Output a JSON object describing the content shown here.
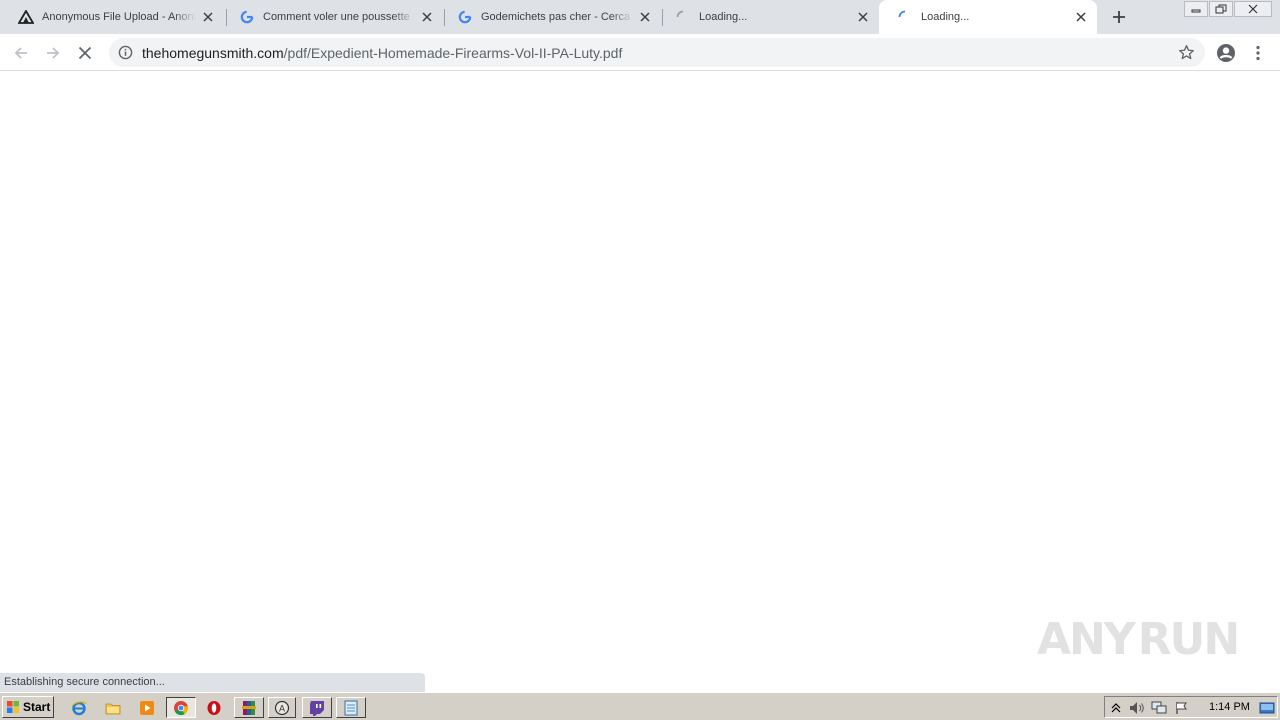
{
  "browser": {
    "tabs": [
      {
        "title": "Anonymous File Upload - AnonFiles",
        "favicon": "anonfiles-icon",
        "state": "inactive"
      },
      {
        "title": "Comment voler une poussette ?",
        "favicon": "google-g-icon",
        "state": "inactive"
      },
      {
        "title": "Godemichets pas cher - Cerca con Google",
        "favicon": "google-g-icon",
        "state": "inactive"
      },
      {
        "title": "Loading...",
        "favicon": "loading-spinner-icon",
        "state": "inactive"
      },
      {
        "title": "Loading...",
        "favicon": "loading-spinner-icon",
        "state": "active"
      }
    ],
    "address": {
      "host": "thehomegunsmith.com",
      "path": "/pdf/Expedient-Homemade-Firearms-Vol-II-PA-Luty.pdf"
    },
    "status_text": "Establishing secure connection...",
    "colors": {
      "tabstrip": "#dee1e6",
      "omnibox": "#f1f3f4",
      "accent_blue": "#4285f4"
    }
  },
  "watermark": {
    "left": "ANY",
    "right": "RUN"
  },
  "taskbar": {
    "start_label": "Start",
    "quick_launch": [
      "ie-icon",
      "explorer-folder-icon",
      "media-player-icon",
      "chrome-icon",
      "opera-icon",
      "winrar-icon",
      "wordpad-icon",
      "twitch-icon",
      "notepad-icon"
    ],
    "clock": "1:14 PM"
  }
}
